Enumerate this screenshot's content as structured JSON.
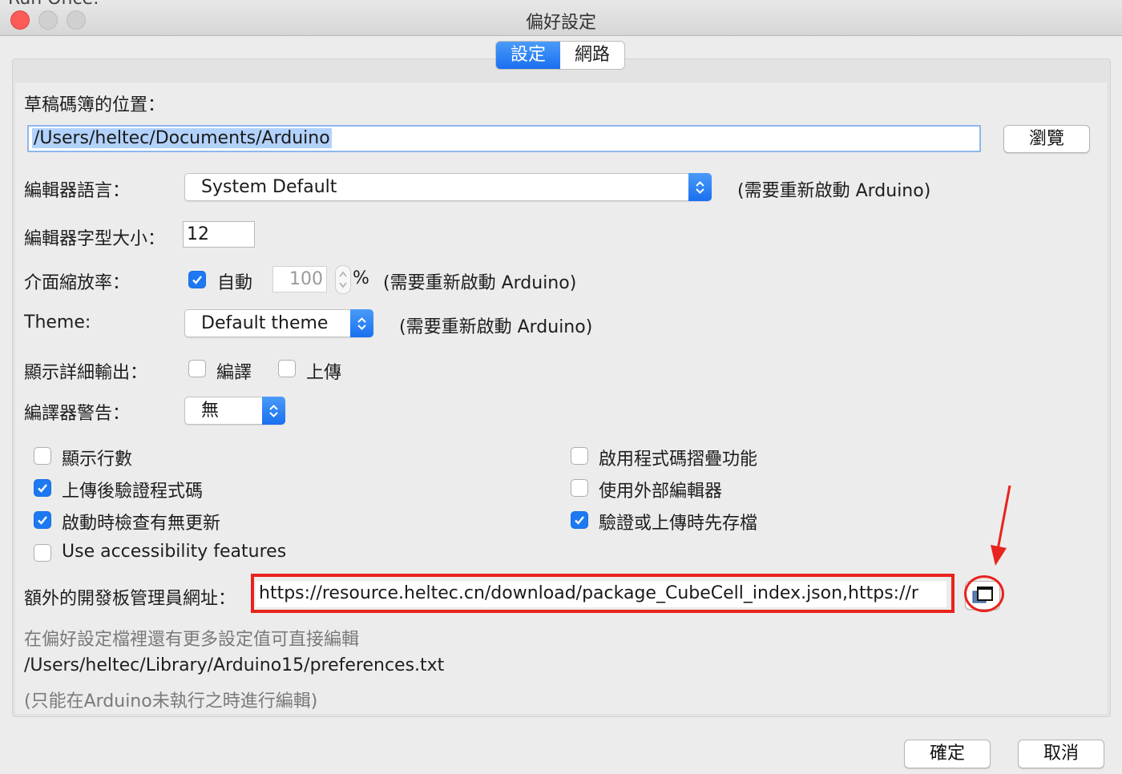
{
  "window": {
    "behind_text": "Run Once:",
    "title": "偏好設定"
  },
  "tabs": [
    {
      "label": "設定",
      "active": true
    },
    {
      "label": "網路",
      "active": false
    }
  ],
  "settings": {
    "sketchbook_label": "草稿碼簿的位置：",
    "sketchbook_path": "/Users/heltec/Documents/Arduino",
    "browse_label": "瀏覽",
    "editor_language_label": "編輯器語言：",
    "editor_language_value": "System Default",
    "restart_note": "(需要重新啟動 Arduino)",
    "font_size_label": "編輯器字型大小：",
    "font_size_value": "12",
    "scale_label": "介面縮放率：",
    "scale_auto_label": "自動",
    "scale_auto_checked": true,
    "scale_value": "100",
    "scale_unit": "%",
    "theme_label": "Theme:",
    "theme_value": "Default theme",
    "verbose_label": "顯示詳細輸出：",
    "verbose_compile_label": "編譯",
    "verbose_compile_checked": false,
    "verbose_upload_label": "上傳",
    "verbose_upload_checked": false,
    "warnings_label": "編譯器警告：",
    "warnings_value": "無"
  },
  "checkboxes_left": [
    {
      "label": "顯示行數",
      "checked": false
    },
    {
      "label": "上傳後驗證程式碼",
      "checked": true
    },
    {
      "label": "啟動時檢查有無更新",
      "checked": true
    },
    {
      "label": "Use accessibility features",
      "checked": false
    }
  ],
  "checkboxes_right": [
    {
      "label": "啟用程式碼摺疊功能",
      "checked": false
    },
    {
      "label": "使用外部編輯器",
      "checked": false
    },
    {
      "label": "驗證或上傳時先存檔",
      "checked": true
    }
  ],
  "boards_url": {
    "label": "額外的開發板管理員網址：",
    "value": "https://resource.heltec.cn/download/package_CubeCell_index.json,https://r"
  },
  "footer": {
    "more_prefs_note": "在偏好設定檔裡還有更多設定值可直接編輯",
    "prefs_path": "/Users/heltec/Library/Arduino15/preferences.txt",
    "edit_note": "(只能在Arduino未執行之時進行編輯)"
  },
  "buttons": {
    "ok": "確定",
    "cancel": "取消"
  },
  "colors": {
    "accent": "#1d79f1",
    "annotation_red": "#e8231d"
  }
}
